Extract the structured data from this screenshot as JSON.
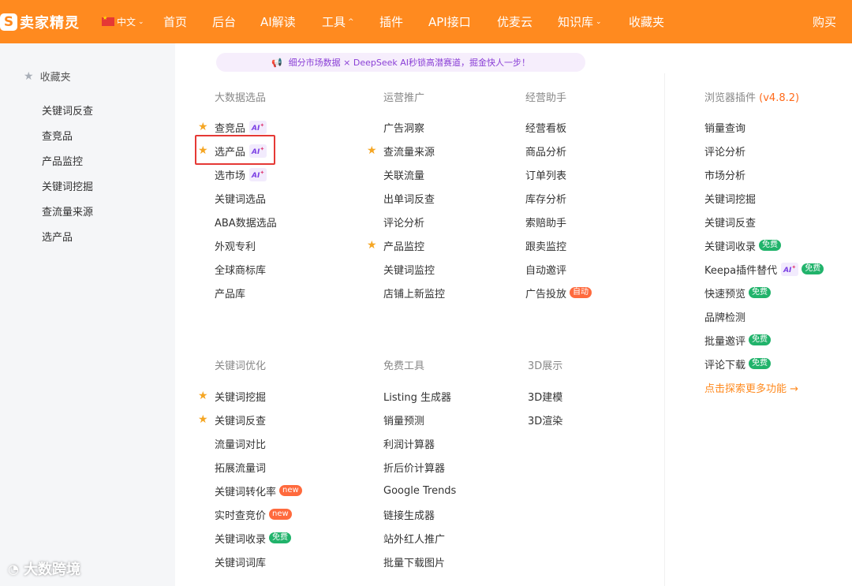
{
  "topbar": {
    "logo_mark": "S",
    "logo_text": "卖家精灵",
    "language": "中文",
    "nav": [
      {
        "label": "首页",
        "has_dropdown": false
      },
      {
        "label": "后台",
        "has_dropdown": false
      },
      {
        "label": "AI解读",
        "has_dropdown": false
      },
      {
        "label": "工具",
        "has_dropdown": true
      },
      {
        "label": "插件",
        "has_dropdown": false
      },
      {
        "label": "API接口",
        "has_dropdown": false
      },
      {
        "label": "优麦云",
        "has_dropdown": false
      },
      {
        "label": "知识库",
        "has_dropdown": true
      },
      {
        "label": "收藏夹",
        "has_dropdown": false
      }
    ],
    "buy_label": "购买",
    "colors": {
      "brand": "#ff8a1f"
    }
  },
  "sidebar": {
    "title": "收藏夹",
    "items": [
      "关键词反查",
      "查竞品",
      "产品监控",
      "关键词挖掘",
      "查流量来源",
      "选产品"
    ]
  },
  "promo": {
    "text": "细分市场数据 × DeepSeek AI秒锁高潜赛道，掘金快人一步！"
  },
  "badges": {
    "ai": "AI",
    "ai_spark": "✦",
    "new": "new",
    "free": "免费",
    "auto": "自动"
  },
  "sections": {
    "big_data": {
      "title": "大数据选品",
      "items": [
        "查竞品",
        "选产品",
        "选市场",
        "关键词选品",
        "ABA数据选品",
        "外观专利",
        "全球商标库",
        "产品库"
      ]
    },
    "ops": {
      "title": "运营推广",
      "items": [
        "广告洞察",
        "查流量来源",
        "关联流量",
        "出单词反查",
        "评论分析",
        "产品监控",
        "关键词监控",
        "店铺上新监控"
      ]
    },
    "assistant": {
      "title": "经营助手",
      "items": [
        "经营看板",
        "商品分析",
        "订单列表",
        "库存分析",
        "索赔助手",
        "跟卖监控",
        "自动邀评",
        "广告投放"
      ]
    },
    "plugin": {
      "title": "浏览器插件",
      "version": "(v4.8.2)",
      "items": [
        "销量查询",
        "评论分析",
        "市场分析",
        "关键词挖掘",
        "关键词反查",
        "关键词收录",
        "Keepa插件替代",
        "快速预览",
        "品牌检测",
        "批量邀评",
        "评论下载"
      ],
      "more": "点击探索更多功能 →"
    },
    "keyword_opt": {
      "title": "关键词优化",
      "items": [
        "关键词挖掘",
        "关键词反查",
        "流量词对比",
        "拓展流量词",
        "关键词转化率",
        "实时查竞价",
        "关键词收录",
        "关键词词库"
      ]
    },
    "free_tools": {
      "title": "免费工具",
      "items": [
        "Listing 生成器",
        "销量预测",
        "利润计算器",
        "折后价计算器",
        "Google Trends",
        "链接生成器",
        "站外红人推广",
        "批量下载图片"
      ]
    }
  },
  "three_d": {
    "title": "3D展示",
    "items": [
      "3D建模",
      "3D渲染"
    ]
  },
  "watermark": "大数跨境"
}
